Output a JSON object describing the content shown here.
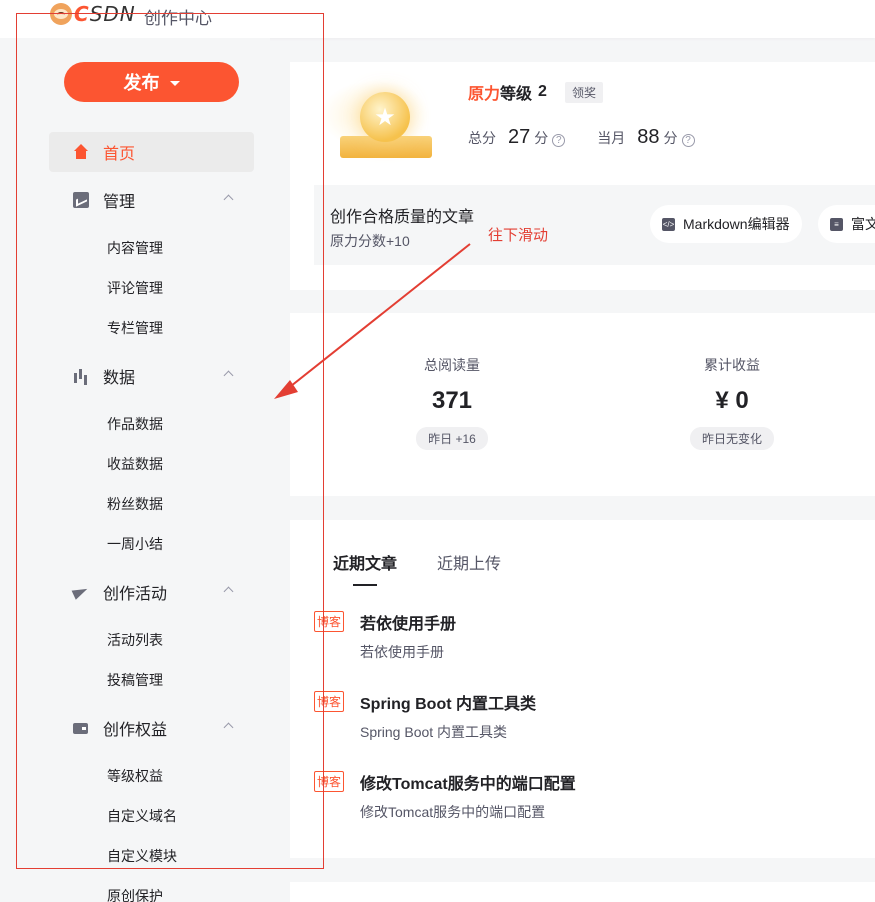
{
  "header": {
    "logo_main": "C",
    "logo_rest": "SDN",
    "subtitle": "创作中心"
  },
  "sidebar": {
    "publish_label": "发布",
    "home_label": "首页",
    "groups": [
      {
        "label": "管理",
        "icon": "trend-chart-icon",
        "items": [
          "内容管理",
          "评论管理",
          "专栏管理"
        ]
      },
      {
        "label": "数据",
        "icon": "bar-chart-icon",
        "items": [
          "作品数据",
          "收益数据",
          "粉丝数据",
          "一周小结"
        ]
      },
      {
        "label": "创作活动",
        "icon": "paper-plane-icon",
        "items": [
          "活动列表",
          "投稿管理"
        ]
      },
      {
        "label": "创作权益",
        "icon": "wallet-icon",
        "items": [
          "等级权益",
          "自定义域名",
          "自定义模块",
          "原创保护"
        ]
      }
    ]
  },
  "level": {
    "title_hl": "原力",
    "title_rest": "等级",
    "value": "2",
    "claim_label": "领奖",
    "total_label": "总分",
    "total_value": "27",
    "month_label": "当月",
    "month_value": "88",
    "unit": "分",
    "help_glyph": "?"
  },
  "task": {
    "title": "创作合格质量的文章",
    "subtitle": "原力分数+10",
    "editor_markdown": "Markdown编辑器",
    "editor_rich": "富文"
  },
  "stats": {
    "read_label": "总阅读量",
    "read_value": "371",
    "read_delta": "昨日 +16",
    "income_label": "累计收益",
    "income_value": "¥ 0",
    "income_delta": "昨日无变化"
  },
  "recent": {
    "tabs": [
      "近期文章",
      "近期上传"
    ],
    "tag_label": "博客",
    "articles": [
      {
        "title": "若依使用手册",
        "subtitle": "若依使用手册"
      },
      {
        "title": "Spring Boot 内置工具类",
        "subtitle": "Spring Boot 内置工具类"
      },
      {
        "title": "修改Tomcat服务中的端口配置",
        "subtitle": "修改Tomcat服务中的端口配置"
      }
    ]
  },
  "annotation": {
    "text": "往下滑动",
    "color": "#e33e33"
  },
  "colors": {
    "brand": "#fc5531",
    "annotation": "#e33e33",
    "bg": "#f5f6f7"
  }
}
